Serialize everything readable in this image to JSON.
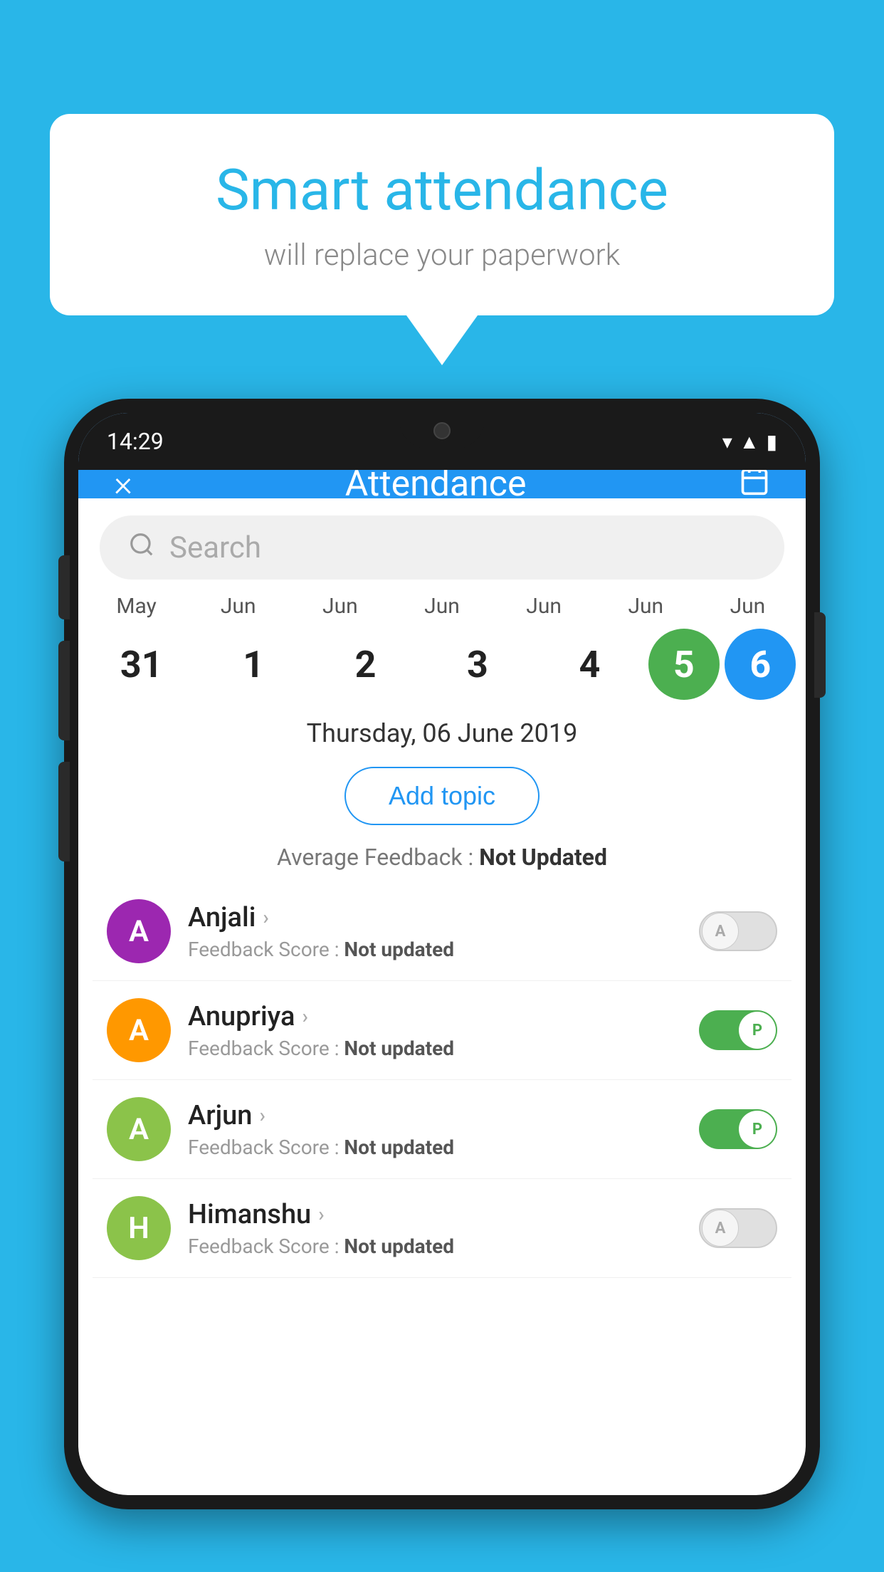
{
  "background_color": "#29b6e8",
  "speech_bubble": {
    "title": "Smart attendance",
    "subtitle": "will replace your paperwork"
  },
  "phone": {
    "status_bar": {
      "time": "14:29"
    },
    "app": {
      "header": {
        "title": "Attendance",
        "close_label": "×",
        "calendar_icon": "📅"
      },
      "search": {
        "placeholder": "Search"
      },
      "calendar": {
        "months": [
          "May",
          "Jun",
          "Jun",
          "Jun",
          "Jun",
          "Jun",
          "Jun"
        ],
        "dates": [
          "31",
          "1",
          "2",
          "3",
          "4",
          "5",
          "6"
        ],
        "selected_green": "5",
        "selected_blue": "6"
      },
      "selected_date_label": "Thursday, 06 June 2019",
      "add_topic_label": "Add topic",
      "avg_feedback_label": "Average Feedback : ",
      "avg_feedback_value": "Not Updated",
      "students": [
        {
          "name": "Anjali",
          "avatar_letter": "A",
          "avatar_color": "#9c27b0",
          "score_label": "Feedback Score : ",
          "score_value": "Not updated",
          "toggle_state": "off",
          "toggle_letter": "A"
        },
        {
          "name": "Anupriya",
          "avatar_letter": "A",
          "avatar_color": "#ff9800",
          "score_label": "Feedback Score : ",
          "score_value": "Not updated",
          "toggle_state": "on",
          "toggle_letter": "P"
        },
        {
          "name": "Arjun",
          "avatar_letter": "A",
          "avatar_color": "#8bc34a",
          "score_label": "Feedback Score : ",
          "score_value": "Not updated",
          "toggle_state": "on",
          "toggle_letter": "P"
        },
        {
          "name": "Himanshu",
          "avatar_letter": "H",
          "avatar_color": "#8bc34a",
          "score_label": "Feedback Score : ",
          "score_value": "Not updated",
          "toggle_state": "off",
          "toggle_letter": "A"
        }
      ]
    }
  }
}
